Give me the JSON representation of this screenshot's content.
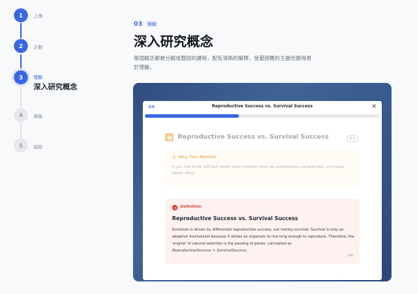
{
  "steps": [
    {
      "number": "1",
      "label": "上傳",
      "state": "done"
    },
    {
      "number": "2",
      "label": "計劃",
      "state": "done"
    },
    {
      "number": "3",
      "label": "理解",
      "title": "深入研究概念",
      "state": "current"
    },
    {
      "number": "4",
      "label": "掌握",
      "state": "todo"
    },
    {
      "number": "5",
      "label": "協助",
      "state": "todo"
    }
  ],
  "header": {
    "step_number": "03",
    "step_name": "理解",
    "title": "深入研究概念",
    "description": "每個概念都被分解成簡短的課程，配有清晰的解釋，使最困難的主題也變得易於理解。"
  },
  "modal": {
    "count": "2/6",
    "title": "Reproductive Success vs. Survival Success",
    "progress": 0.4,
    "close_glyph": "×",
    "card_title": "Reproductive Success vs. Survival Success",
    "badge": "A 5",
    "why": {
      "label": "Why This Matters",
      "text": "If you live to be 100 but never have children, from an evolutionary perspective, you have failed. Why?"
    },
    "definition": {
      "label": "Definition",
      "title": "Reproductive Success vs. Survival Success",
      "text": "Evolution is driven by differential reproductive success, not merely survival. Survival is only an adaptive mechanism because it allows an organism to live long enough to reproduce. Therefore, the 'engine' of natural selection is the passing of genes, calculated as",
      "formula": "ReproductiveSuccess > SurvivalSuccess."
    }
  },
  "colors": {
    "accent": "#3a66e6",
    "why": "#e89a3d",
    "definition": "#d94335",
    "preview_bg": "#36598e"
  },
  "icons": {
    "card": "book-icon",
    "why": "lightbulb-icon",
    "definition": "alert-icon",
    "close": "close-icon"
  }
}
